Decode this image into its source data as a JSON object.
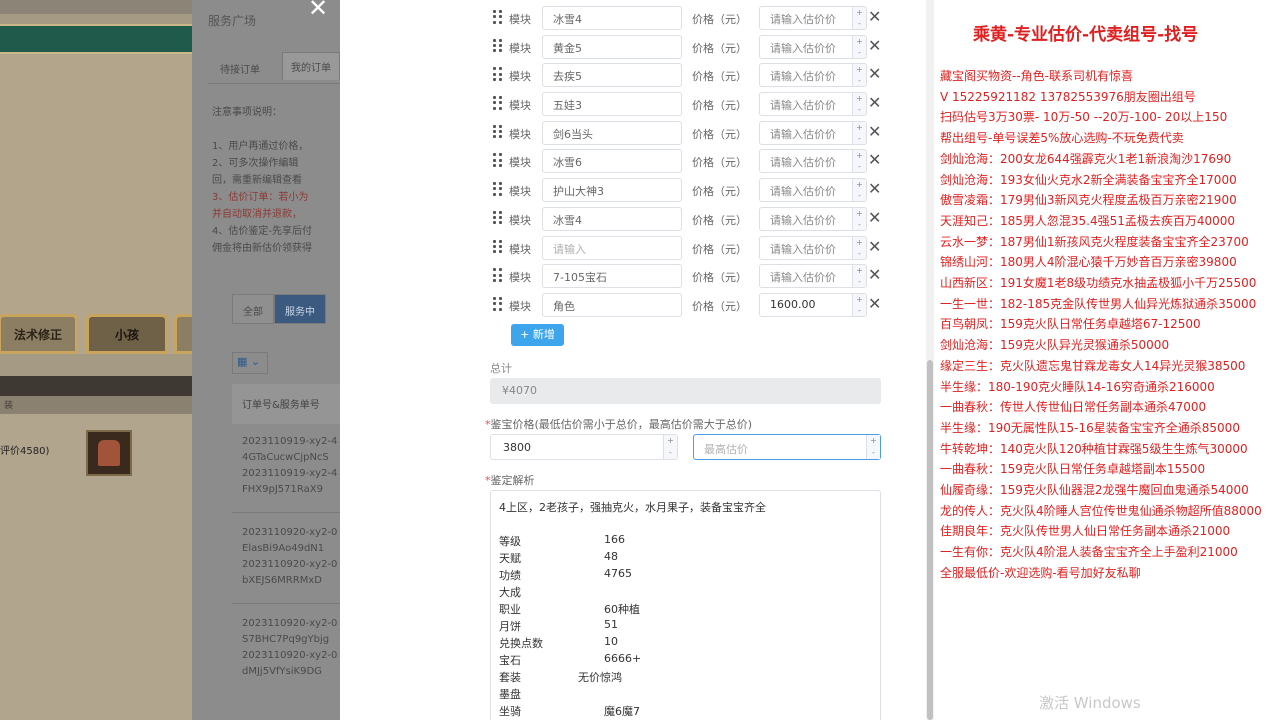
{
  "game": {
    "tab_left": "法术修正",
    "tab_mid": "小孩",
    "header_sub": "装",
    "item_text": "评价4580)"
  },
  "service": {
    "close": "✕",
    "title": "服务广场",
    "tab1": "待接订单",
    "tab2": "我的订单",
    "notes": [
      {
        "text": "注意事项说明：",
        "red": false
      },
      {
        "text": "",
        "red": false
      },
      {
        "text": "1、用户再通过价格，",
        "red": false
      },
      {
        "text": "2、可多次操作编辑",
        "red": false
      },
      {
        "text": "回，需重新编辑查看",
        "red": false
      },
      {
        "text": "3、估价订单：若小为",
        "red": true
      },
      {
        "text": "并自动取消并退款，",
        "red": true
      },
      {
        "text": "4、估价鉴定-先享后付",
        "red": false
      },
      {
        "text": "佣金将由新估价领获得",
        "red": false
      }
    ],
    "filter_all": "全部",
    "filter_active": "服务中",
    "grid_icon": "▦ ⌄",
    "col_header": "订单号&服务单号",
    "orders": [
      [
        "2023110919-xy2-4",
        "4GTaCucwCjpNcS",
        "2023110919-xy2-4",
        "FHX9pJ571RaX9"
      ],
      [
        "2023110920-xy2-0",
        "ElasBi9Ao49dN1",
        "2023110920-xy2-0",
        "bXEJS6MRRMxD"
      ],
      [
        "2023110920-xy2-0",
        "S7BHC7Pq9gYbjg",
        "2023110920-xy2-0",
        "dMJj5VfYsiK9DG"
      ]
    ]
  },
  "form": {
    "module_label": "模块",
    "price_label": "价格（元）",
    "price_placeholder": "请输入估价价",
    "rows": [
      {
        "module": "冰雪4",
        "price": "",
        "placeholder": false
      },
      {
        "module": "黄金5",
        "price": "",
        "placeholder": false
      },
      {
        "module": "去疾5",
        "price": "",
        "placeholder": false
      },
      {
        "module": "五娃3",
        "price": "",
        "placeholder": false
      },
      {
        "module": "剑6当头",
        "price": "",
        "placeholder": false
      },
      {
        "module": "冰雪6",
        "price": "",
        "placeholder": false
      },
      {
        "module": "护山大神3",
        "price": "",
        "placeholder": false
      },
      {
        "module": "冰雪4",
        "price": "",
        "placeholder": false
      },
      {
        "module": "请输入",
        "price": "",
        "placeholder": true
      },
      {
        "module": "7-105宝石",
        "price": "",
        "placeholder": false
      },
      {
        "module": "角色",
        "price": "1600.00",
        "placeholder": false
      }
    ],
    "add_button": "+ 新增",
    "total_label": "总计",
    "total_value": "¥4070",
    "appraisal_label": "鉴宝价格(最低估价需小于总价，最高估价需大于总价)",
    "min_price": "3800",
    "max_placeholder": "最高估价",
    "analysis_label": "鉴定解析",
    "analysis_head": "4上区，2老孩子，强抽克火，水月果子，装备宝宝齐全",
    "analysis_rows": [
      {
        "k": "等级",
        "v": "166"
      },
      {
        "k": "天赋",
        "v": "48"
      },
      {
        "k": "功绩",
        "v": "4765"
      },
      {
        "k": "大成",
        "v": ""
      },
      {
        "k": "职业",
        "v": "60种植"
      },
      {
        "k": "月饼",
        "v": "51"
      },
      {
        "k": "兑换点数",
        "v": "10"
      },
      {
        "k": "宝石",
        "v": "6666+"
      },
      {
        "k": "套装",
        "v": "无价惊鸿",
        "tz": true
      },
      {
        "k": "墨盘",
        "v": ""
      },
      {
        "k": "坐骑",
        "v": "魔6魔7"
      }
    ]
  },
  "overlay": {
    "title": "乘黄-专业估价-代卖组号-找号",
    "lines": [
      "藏宝阁买物资--角色-联系司机有惊喜",
      "V 15225921182  13782553976朋友圈出组号",
      "扫码估号3万30票- 10万-50 --20万-100- 20以上150",
      "帮出组号-单号误差5%放心选购-不玩免费代卖",
      "剑灿沧海：200女龙644强霹克火1老1新浪淘沙17690",
      "剑灿沧海：193女仙火克水2新全满装备宝宝齐全17000",
      "傲雪凌霜：179男仙3新风克火程度孟极百万亲密21900",
      "天涯知己：185男人忽混35.4强51孟极去疾百万40000",
      "云水一梦：187男仙1新孩风克火程度装备宝宝齐全23700",
      "锦绣山河：180男人4阶混心猿千万妙音百万亲密39800",
      "山西新区：191女魔1老8级功绩克水抽孟极狐小千万25500",
      "一生一世：182-185克金队传世男人仙异光炼狱通杀35000",
      "百鸟朝凤：159克火队日常任务卓越塔67-12500",
      "剑灿沧海：159克火队异光灵猴通杀50000",
      "缘定三生：克火队遗忘鬼甘霖龙毒女人14异光灵猴38500",
      "半生缘：180-190克火睡队14-16穷奇通杀216000",
      "一曲春秋：传世人传世仙日常任务副本通杀47000",
      "半生缘：190无属性队15-16星装备宝宝齐全通杀85000",
      "牛转乾坤：140克火队120种植甘霖强5级生生炼气30000",
      "一曲春秋：159克火队日常任务卓越塔副本15500",
      "仙履奇缘：159克火队仙器混2龙强牛魔回血鬼通杀54000",
      "龙的传人：克火队4阶睡人宫位传世鬼仙通杀物超所值88000",
      "佳期良年：克火队传世男人仙日常任务副本通杀21000",
      "一生有你：克火队4阶混人装备宝宝齐全上手盈利21000",
      "全服最低价-欢迎选购-看号加好友私聊"
    ],
    "watermark": "激活 Windows"
  }
}
